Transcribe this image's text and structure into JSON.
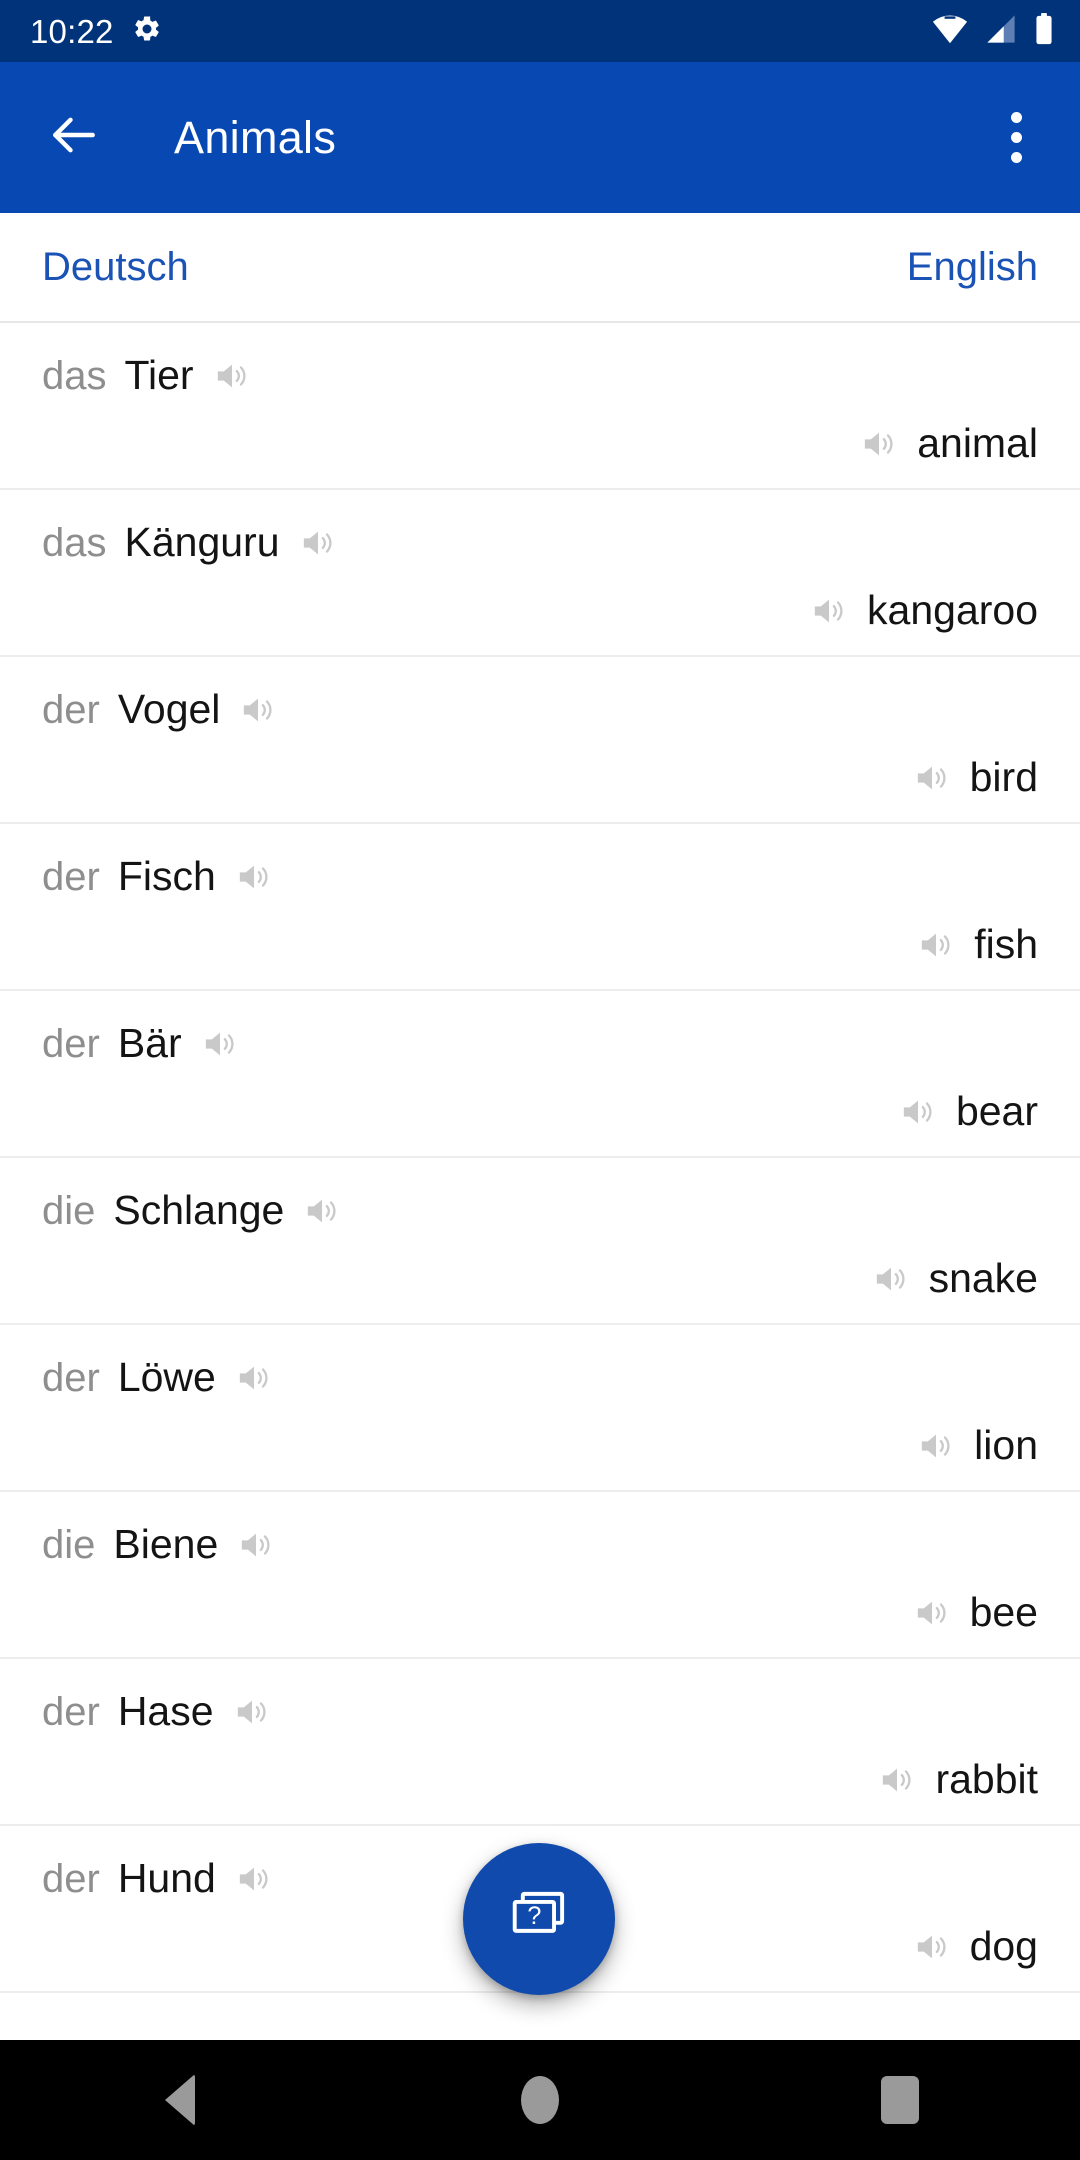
{
  "status_bar": {
    "time": "10:22",
    "icons": [
      "gear-icon",
      "wifi-icon",
      "cellular-signal-icon",
      "battery-icon"
    ],
    "background_color": "#00337a"
  },
  "app_bar": {
    "back_icon": "arrow-left-icon",
    "title": "Animals",
    "overflow_icon": "more-vertical-icon",
    "background_color": "#0848b3"
  },
  "language_header": {
    "source_language": "Deutsch",
    "target_language": "English",
    "accent_color": "#1a52b5"
  },
  "vocabulary": {
    "speaker_icon": "speaker-icon",
    "rows": [
      {
        "article": "das",
        "term": "Tier",
        "translation": "animal"
      },
      {
        "article": "das",
        "term": "Känguru",
        "translation": "kangaroo"
      },
      {
        "article": "der",
        "term": "Vogel",
        "translation": "bird"
      },
      {
        "article": "der",
        "term": "Fisch",
        "translation": "fish"
      },
      {
        "article": "der",
        "term": "Bär",
        "translation": "bear"
      },
      {
        "article": "die",
        "term": "Schlange",
        "translation": "snake"
      },
      {
        "article": "der",
        "term": "Löwe",
        "translation": "lion"
      },
      {
        "article": "die",
        "term": "Biene",
        "translation": "bee"
      },
      {
        "article": "der",
        "term": "Hase",
        "translation": "rabbit"
      },
      {
        "article": "der",
        "term": "Hund",
        "translation": "dog"
      }
    ]
  },
  "fab": {
    "icon": "flashcards-question-icon",
    "label": "?",
    "background_color": "#0f4aac"
  },
  "nav_bar": {
    "back_icon": "triangle-back-icon",
    "home_icon": "circle-home-icon",
    "recents_icon": "square-recents-icon",
    "background_color": "#000000"
  }
}
